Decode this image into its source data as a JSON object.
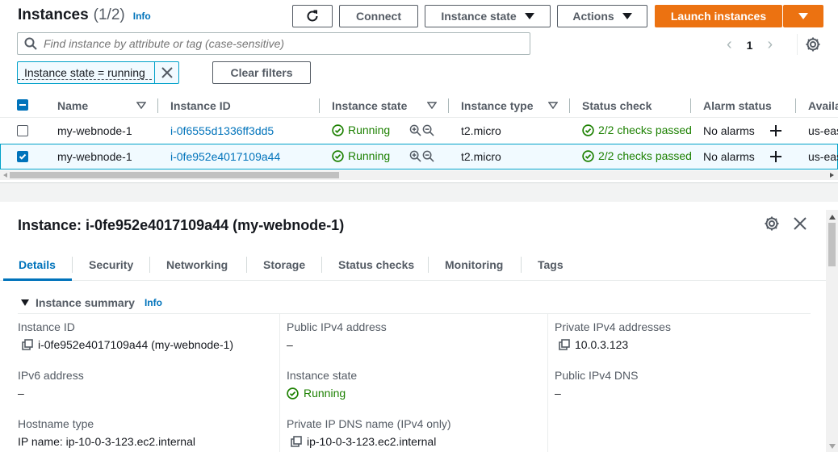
{
  "header": {
    "title": "Instances",
    "count": "(1/2)",
    "info": "Info",
    "buttons": {
      "connect": "Connect",
      "instance_state": "Instance state",
      "actions": "Actions",
      "launch": "Launch instances"
    }
  },
  "search": {
    "placeholder": "Find instance by attribute or tag (case-sensitive)",
    "value": ""
  },
  "pager": {
    "page": "1"
  },
  "filter": {
    "token": "Instance state = running",
    "clear": "Clear filters"
  },
  "table": {
    "columns": [
      "Name",
      "Instance ID",
      "Instance state",
      "Instance type",
      "Status check",
      "Alarm status",
      "Availa"
    ],
    "rows": [
      {
        "name": "my-webnode-1",
        "id": "i-0f6555d1336ff3dd5",
        "state": "Running",
        "type": "t2.micro",
        "status": "2/2 checks passed",
        "alarm": "No alarms",
        "az": "us-eas",
        "selected": false
      },
      {
        "name": "my-webnode-1",
        "id": "i-0fe952e4017109a44",
        "state": "Running",
        "type": "t2.micro",
        "status": "2/2 checks passed",
        "alarm": "No alarms",
        "az": "us-eas",
        "selected": true
      }
    ]
  },
  "detail": {
    "title": "Instance: i-0fe952e4017109a44 (my-webnode-1)",
    "tabs": [
      "Details",
      "Security",
      "Networking",
      "Storage",
      "Status checks",
      "Monitoring",
      "Tags"
    ],
    "section": {
      "title": "Instance summary",
      "info": "Info"
    },
    "fields": {
      "instance_id": {
        "label": "Instance ID",
        "value": "i-0fe952e4017109a44 (my-webnode-1)"
      },
      "public_ipv4": {
        "label": "Public IPv4 address",
        "value": "–"
      },
      "private_ipv4": {
        "label": "Private IPv4 addresses",
        "value": "10.0.3.123"
      },
      "ipv6": {
        "label": "IPv6 address",
        "value": "–"
      },
      "instance_state": {
        "label": "Instance state",
        "value": "Running"
      },
      "public_dns": {
        "label": "Public IPv4 DNS",
        "value": "–"
      },
      "hostname_type": {
        "label": "Hostname type",
        "value": "IP name: ip-10-0-3-123.ec2.internal"
      },
      "private_dns": {
        "label": "Private IP DNS name (IPv4 only)",
        "value": "ip-10-0-3-123.ec2.internal"
      }
    }
  },
  "colors": {
    "accent": "#0073bb",
    "primary": "#ec7211",
    "success": "#1d8102",
    "selected_bg": "#f1faff"
  }
}
